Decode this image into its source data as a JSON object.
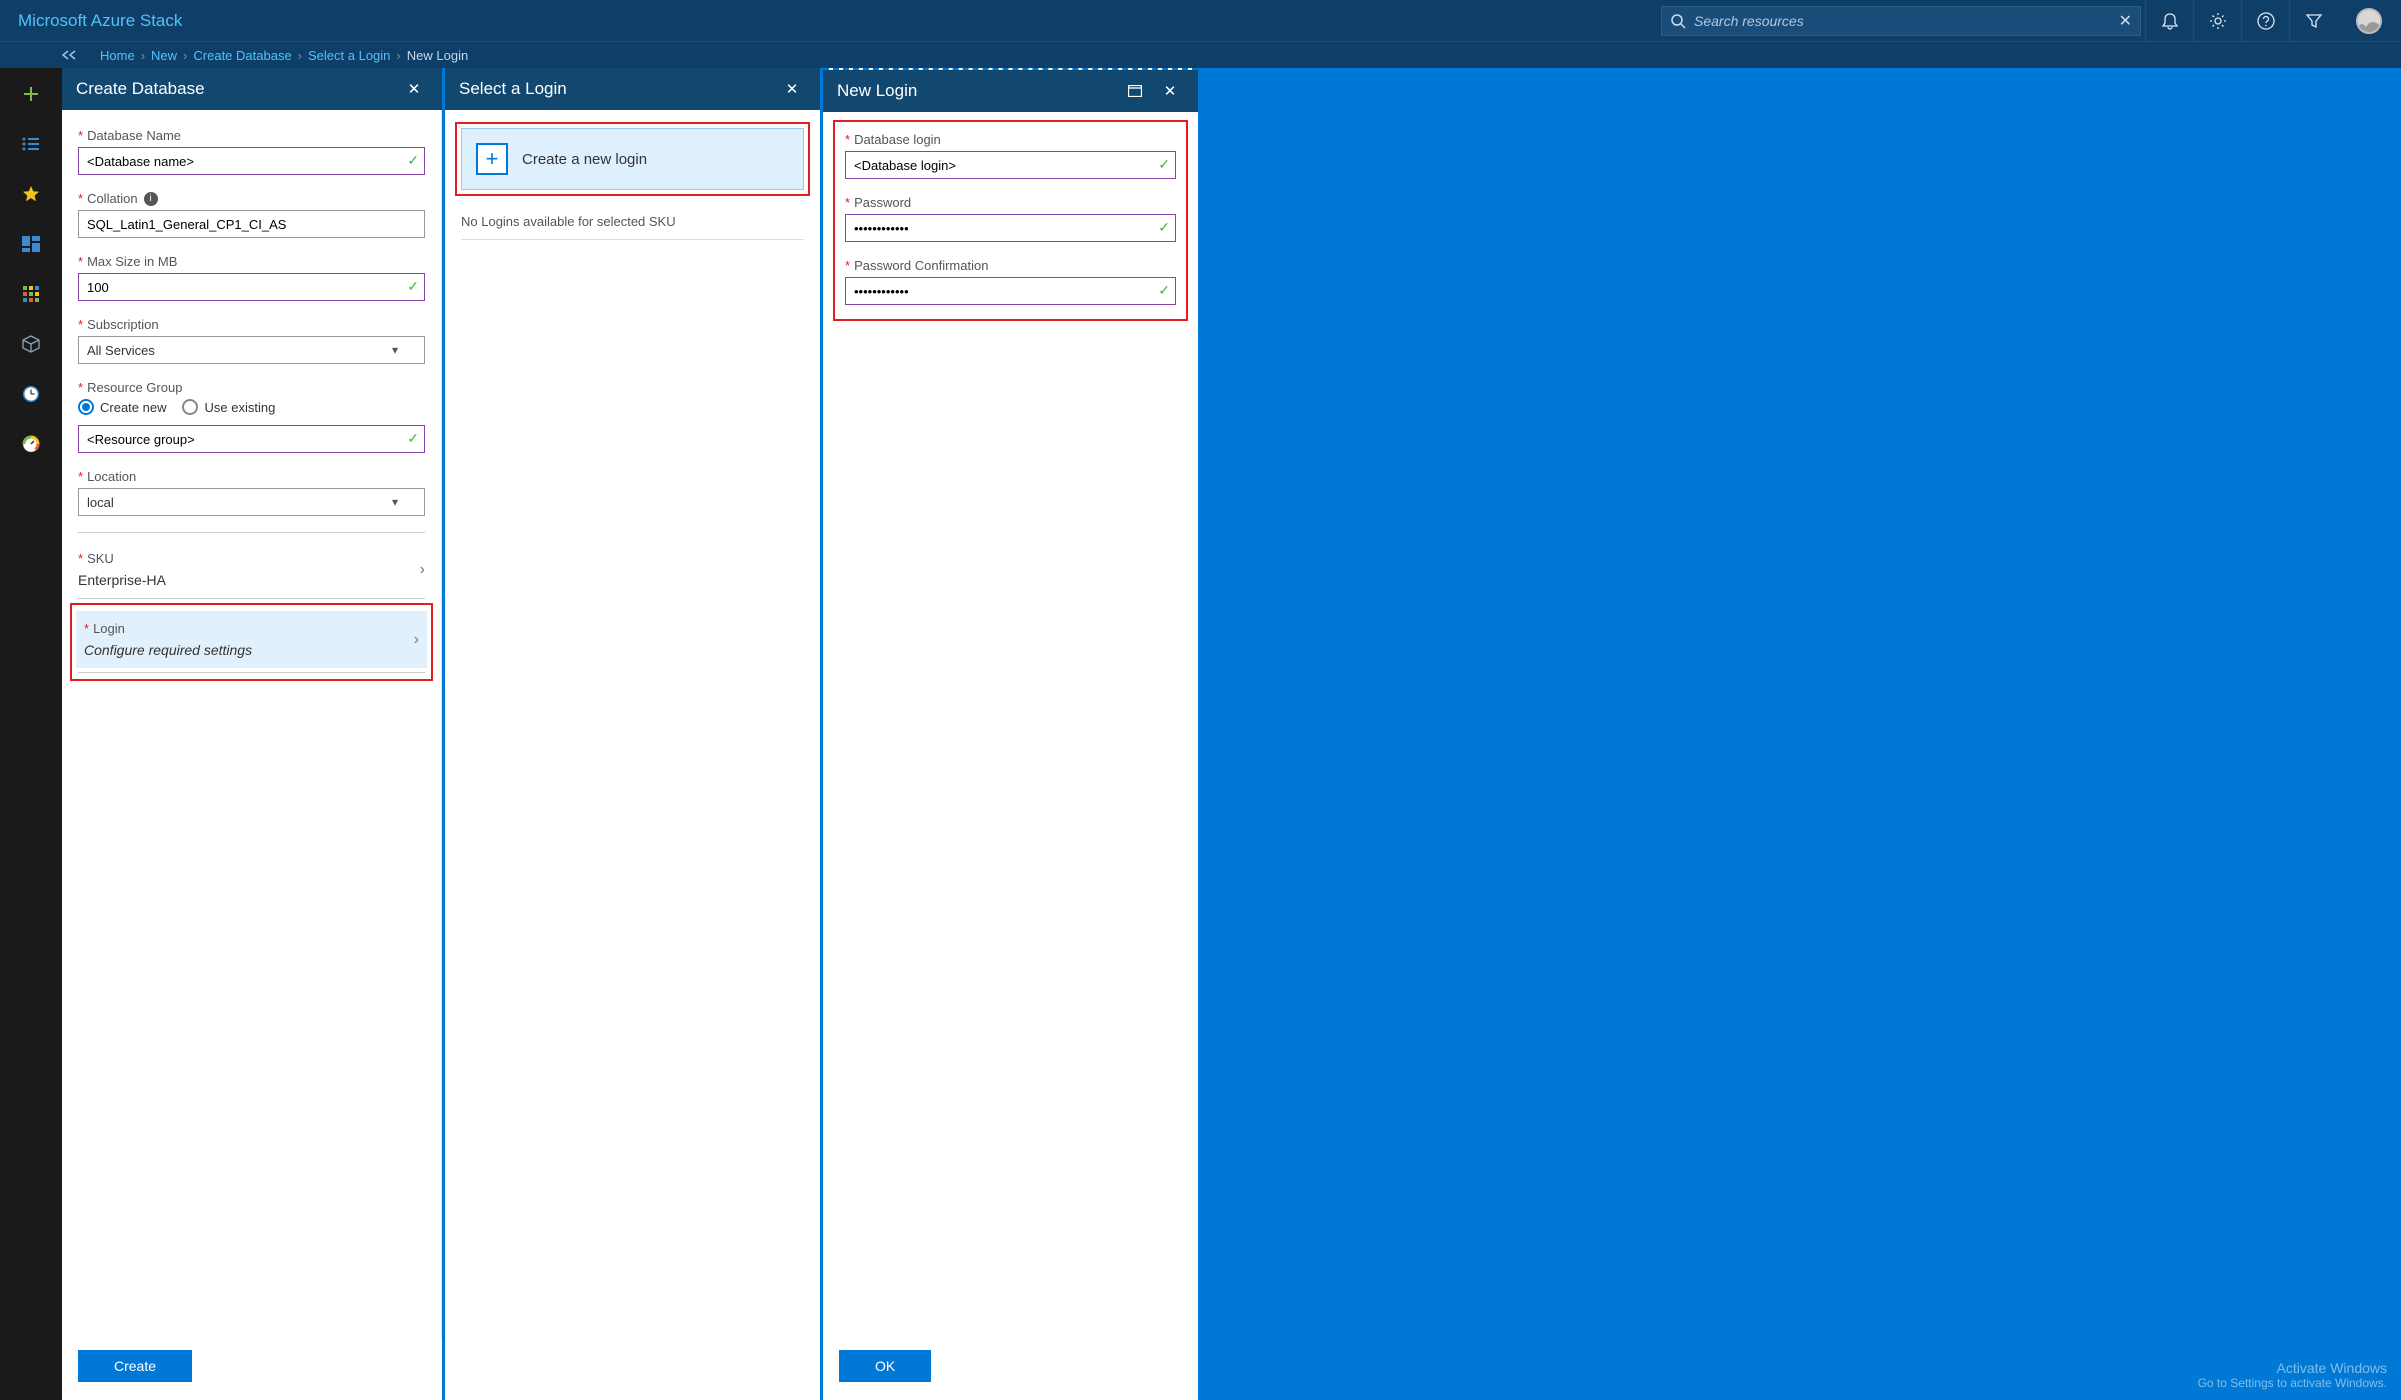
{
  "header": {
    "brand": "Microsoft Azure Stack",
    "search_placeholder": "Search resources"
  },
  "breadcrumb": {
    "items": [
      "Home",
      "New",
      "Create Database",
      "Select a Login"
    ],
    "current": "New Login"
  },
  "blade1": {
    "title": "Create Database",
    "db_name_label": "Database Name",
    "db_name_value": "<Database name>",
    "collation_label": "Collation",
    "collation_value": "SQL_Latin1_General_CP1_CI_AS",
    "maxsize_label": "Max Size in MB",
    "maxsize_value": "100",
    "subscription_label": "Subscription",
    "subscription_value": "All Services",
    "rg_label": "Resource Group",
    "rg_create_new": "Create new",
    "rg_use_existing": "Use existing",
    "rg_value": "<Resource group>",
    "location_label": "Location",
    "location_value": "local",
    "sku_label": "SKU",
    "sku_value": "Enterprise-HA",
    "login_label": "Login",
    "login_value": "Configure required settings",
    "create_btn": "Create"
  },
  "blade2": {
    "title": "Select a Login",
    "create_login_text": "Create a new login",
    "no_logins": "No Logins available for selected SKU"
  },
  "blade3": {
    "title": "New Login",
    "db_login_label": "Database login",
    "db_login_value": "<Database login>",
    "password_label": "Password",
    "password_value": "••••••••••••",
    "password_conf_label": "Password Confirmation",
    "password_conf_value": "••••••••••••",
    "ok_btn": "OK"
  },
  "watermark": {
    "line1": "Activate Windows",
    "line2": "Go to Settings to activate Windows."
  }
}
